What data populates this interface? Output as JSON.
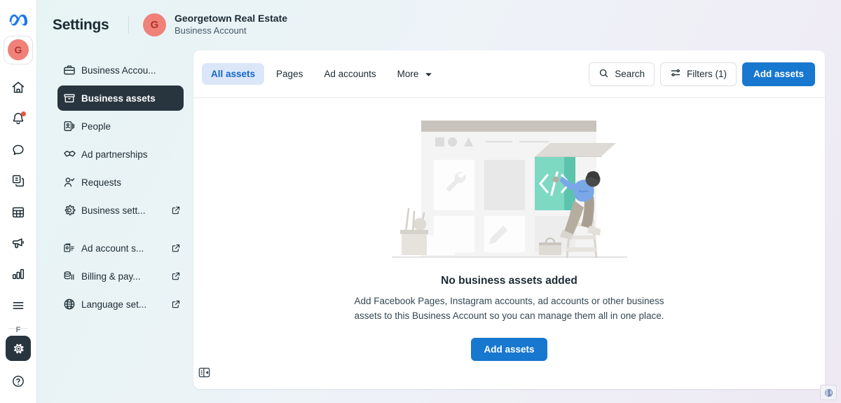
{
  "brand": {
    "logo_icon": "meta-logo-icon",
    "accent_blue": "#1877cf",
    "tab_active_blue": "#1666cb",
    "avatar_bg": "#ef8179",
    "avatar_fg": "#b0322d",
    "nav_active_bg": "#28353f",
    "badge_red": "#e8543f"
  },
  "rail": {
    "avatar_initial": "G",
    "gear_ghost_text": "F",
    "items": [
      {
        "name": "home-icon",
        "label": "Home",
        "badge": false
      },
      {
        "name": "bell-icon",
        "label": "Notifications",
        "badge": true
      },
      {
        "name": "chat-bubble-icon",
        "label": "Messages",
        "badge": false
      },
      {
        "name": "pages-icon",
        "label": "Pages",
        "badge": false
      },
      {
        "name": "table-grid-icon",
        "label": "Table",
        "badge": false
      },
      {
        "name": "megaphone-icon",
        "label": "Ads",
        "badge": false
      },
      {
        "name": "bar-chart-icon",
        "label": "Insights",
        "badge": false
      },
      {
        "name": "hamburger-menu-icon",
        "label": "More",
        "badge": false
      }
    ],
    "bottom": [
      {
        "name": "gear-icon",
        "label": "Settings",
        "active": true
      },
      {
        "name": "help-circle-icon",
        "label": "Help",
        "active": false
      }
    ]
  },
  "header": {
    "title": "Settings",
    "account": {
      "avatar_initial": "G",
      "name": "Georgetown Real Estate",
      "subtitle": "Business Account"
    }
  },
  "sidebar": {
    "collapse_icon": "panel-collapse-icon",
    "items": [
      {
        "icon": "briefcase-icon",
        "label": "Business Accou...",
        "active": false,
        "external": false
      },
      {
        "icon": "archive-box-icon",
        "label": "Business assets",
        "active": true,
        "external": false
      },
      {
        "icon": "people-card-icon",
        "label": "People",
        "active": false,
        "external": false
      },
      {
        "icon": "handshake-icon",
        "label": "Ad partnerships",
        "active": false,
        "external": false
      },
      {
        "icon": "person-check-icon",
        "label": "Requests",
        "active": false,
        "external": false
      },
      {
        "icon": "gear-icon",
        "label": "Business sett...",
        "active": false,
        "external": true
      },
      {
        "icon": "ad-account-icon",
        "label": "Ad account s...",
        "active": false,
        "external": true
      },
      {
        "icon": "billing-stack-icon",
        "label": "Billing & pay...",
        "active": false,
        "external": true
      },
      {
        "icon": "globe-icon",
        "label": "Language set...",
        "active": false,
        "external": true
      }
    ]
  },
  "toolbar": {
    "tabs": [
      {
        "label": "All assets",
        "active": true,
        "caret": false
      },
      {
        "label": "Pages",
        "active": false,
        "caret": false
      },
      {
        "label": "Ad accounts",
        "active": false,
        "caret": false
      },
      {
        "label": "More",
        "active": false,
        "caret": true
      }
    ],
    "search_label": "Search",
    "search_icon": "search-icon",
    "filters_label": "Filters (1)",
    "filters_icon": "filter-sliders-icon",
    "add_assets_label": "Add assets"
  },
  "empty_state": {
    "illustration_name": "storefront-developer-illustration",
    "title": "No business assets added",
    "body": "Add Facebook Pages, Instagram accounts, ad accounts or other business assets to this Business Account so you can manage them all in one place.",
    "cta_label": "Add assets"
  },
  "corner": {
    "icon": "globe-browser-icon"
  }
}
